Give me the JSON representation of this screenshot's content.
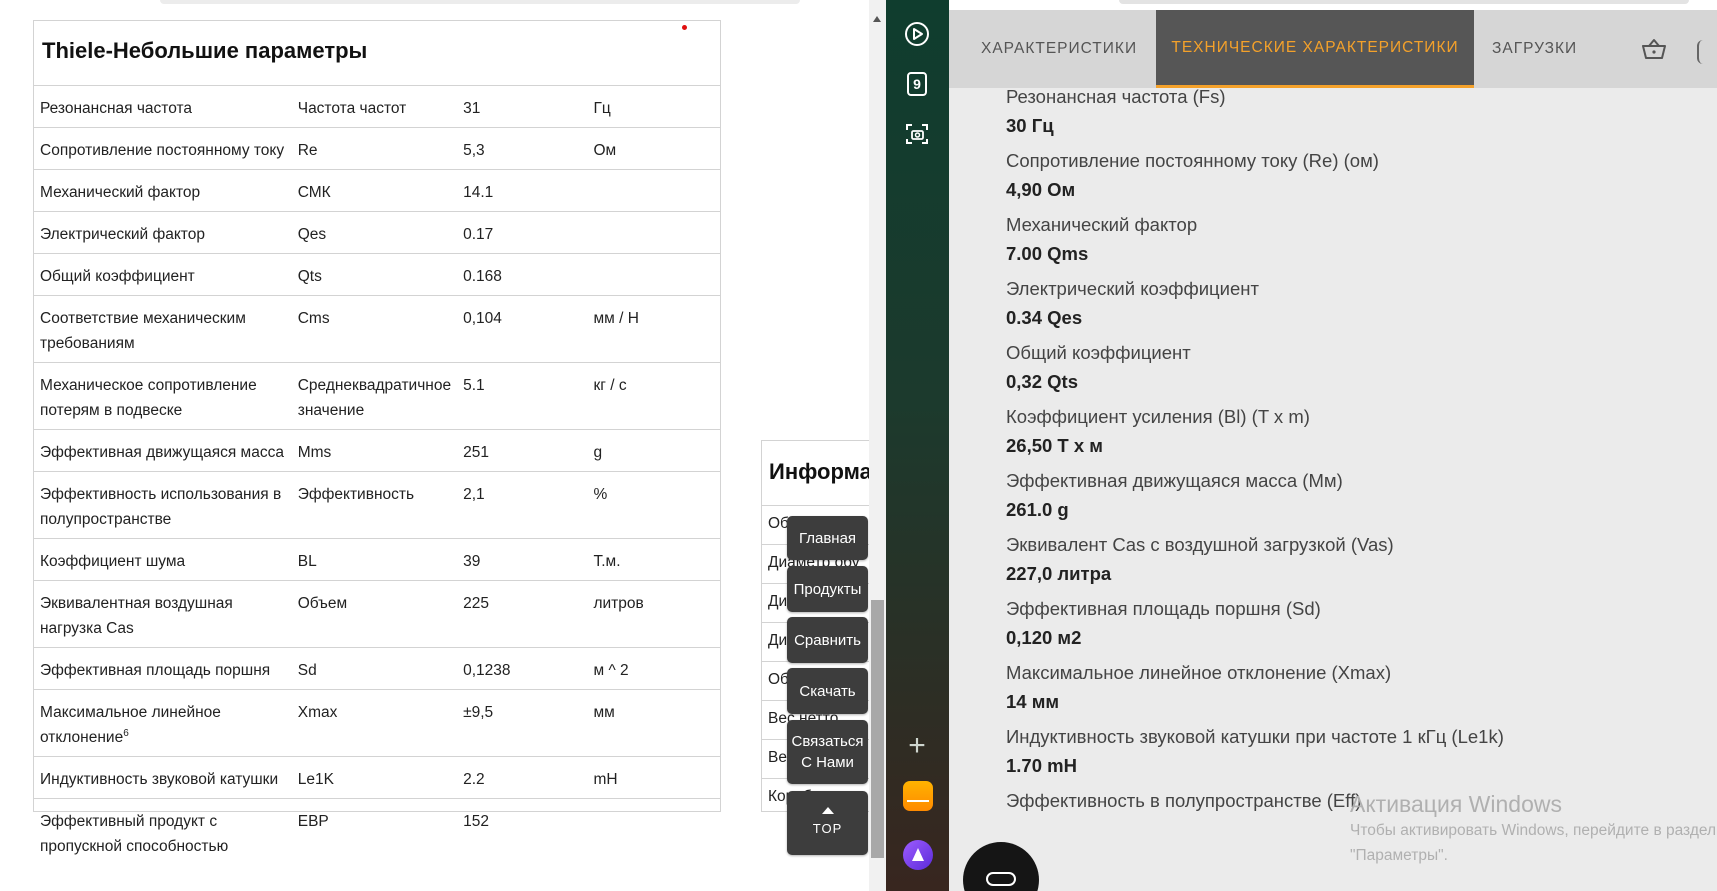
{
  "spec_table": {
    "title": "Thiele-Небольшие параметры",
    "rows": [
      {
        "name": "Резонансная частота",
        "symbol": "Частота частот",
        "value": "31",
        "unit": "Гц"
      },
      {
        "name": "Сопротивление постоянному току",
        "symbol": "Re",
        "value": "5,3",
        "unit": "Ом"
      },
      {
        "name": "Механический фактор",
        "symbol": "СМК",
        "value": "14.1",
        "unit": ""
      },
      {
        "name": "Электрический фактор",
        "symbol": "Qes",
        "value": "0.17",
        "unit": ""
      },
      {
        "name": "Общий коэффициент",
        "symbol": "Qts",
        "value": "0.168",
        "unit": ""
      },
      {
        "name": "Соответствие механическим требованиям",
        "symbol": "Cms",
        "value": "0,104",
        "unit": "мм / Н"
      },
      {
        "name": "Механическое сопротивление потерям в подвеске",
        "symbol": "Среднеквадратичное значение",
        "value": "5.1",
        "unit": "кг / с"
      },
      {
        "name": "Эффективная движущаяся масса",
        "symbol": "Mms",
        "value": "251",
        "unit": "g"
      },
      {
        "name": "Эффективность использования в полупространстве",
        "symbol": "Эффективность",
        "value": "2,1",
        "unit": "%"
      },
      {
        "name": "Коэффициент шума",
        "symbol": "BL",
        "value": "39",
        "unit": "Т.м."
      },
      {
        "name": "Эквивалентная воздушная нагрузка Cas",
        "symbol": "Объем",
        "value": "225",
        "unit": "литров"
      },
      {
        "name": "Эффективная площадь поршня",
        "symbol": "Sd",
        "value": "0,1238",
        "unit": "м ^ 2"
      },
      {
        "name": "Максимальное линейное отклонение",
        "name_sup": "6",
        "symbol": "Xmax",
        "value": "±9,5",
        "unit": "мм"
      },
      {
        "name": "Индуктивность звуковой катушки",
        "symbol": "Le1K",
        "value": "2.2",
        "unit": "mH"
      },
      {
        "name": "Эффективный продукт с пропускной способностью",
        "symbol": "EBP",
        "value": "152",
        "unit": ""
      }
    ]
  },
  "info_panel": {
    "title": "Информа",
    "rows": [
      "Общий",
      "Диаметр обу",
      "Ди",
      "Ди",
      "Об",
      "Вес нетто",
      "Ве",
      "Коробка для"
    ]
  },
  "floating_nav": {
    "home": "Главная",
    "products": "Продукты",
    "compare": "Сравнить",
    "download": "Скачать",
    "contact_line1": "Связаться",
    "contact_line2": "С Нами",
    "top": "TOP"
  },
  "sidebar": {
    "cards_count": "9",
    "icons": [
      "play-icon",
      "cards-icon",
      "screenshot-icon",
      "add-icon",
      "mail-icon",
      "alice-icon"
    ]
  },
  "right_panel": {
    "tabs": {
      "features": "ХАРАКТЕРИСТИКИ",
      "tech_specs": "ТЕХНИЧЕСКИЕ ХАРАКТЕРИСТИКИ",
      "downloads": "ЗАГРУЗКИ"
    },
    "active_tab_color": "#f4a12a",
    "specs": [
      {
        "label": "Резонансная частота (Fs)",
        "value": "30 Гц"
      },
      {
        "label": "Сопротивление постоянному току (Re) (ом)",
        "value": "4,90 Ом"
      },
      {
        "label": "Механический фактор",
        "value": "7.00 Qms"
      },
      {
        "label": "Электрический коэффициент",
        "value": "0.34 Qes"
      },
      {
        "label": "Общий коэффициент",
        "value": "0,32 Qts"
      },
      {
        "label": "Коэффициент усиления (Bl) (T x m)",
        "value": "26,50 T x м"
      },
      {
        "label": "Эффективная движущаяся масса (Мм)",
        "value": "261.0 g"
      },
      {
        "label": "Эквивалент Cas с воздушной загрузкой (Vas)",
        "value": "227,0 литра"
      },
      {
        "label": "Эффективная площадь поршня (Sd)",
        "value": "0,120 м2"
      },
      {
        "label": "Максимальное линейное отклонение (Xmax)",
        "value": "14 мм"
      },
      {
        "label": "Индуктивность звуковой катушки при частоте 1 кГц (Le1k)",
        "value": "1.70 mH"
      },
      {
        "label": "Эффективность в полупространстве (Eff)",
        "value": ""
      }
    ]
  },
  "watermark": {
    "title": "Активация Windows",
    "subtitle": "Чтобы активировать Windows, перейдите в раздел \"Параметры\"."
  }
}
